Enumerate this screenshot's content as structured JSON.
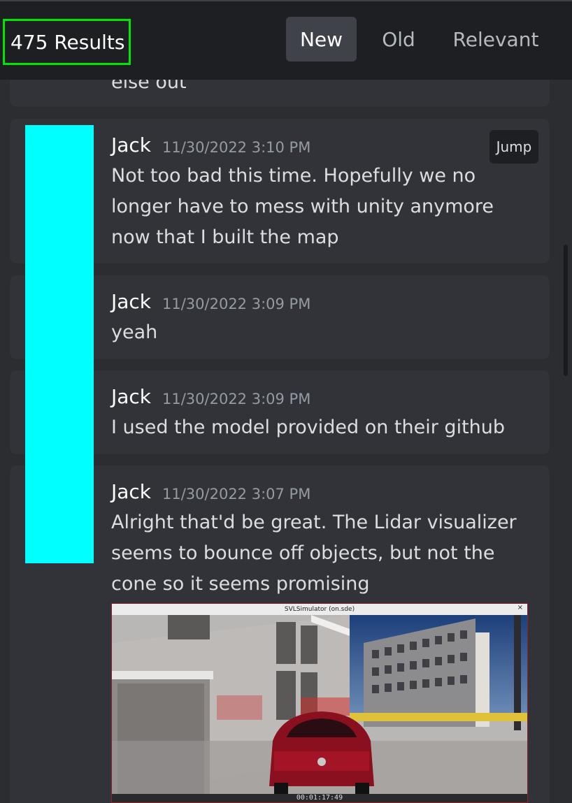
{
  "header": {
    "results_label": "475 Results",
    "sort_tabs": [
      {
        "label": "New",
        "active": true
      },
      {
        "label": "Old",
        "active": false
      },
      {
        "label": "Relevant",
        "active": false
      }
    ]
  },
  "partial_message": {
    "text": "else out"
  },
  "messages": [
    {
      "author": "Jack",
      "timestamp": "11/30/2022 3:10 PM",
      "lines": [
        "Not too bad this time. Hopefully we no",
        "longer have to mess with unity anymore",
        "now that I built the map"
      ],
      "jump_label": "Jump"
    },
    {
      "author": "Jack",
      "timestamp": "11/30/2022 3:09 PM",
      "lines": [
        "yeah"
      ]
    },
    {
      "author": "Jack",
      "timestamp": "11/30/2022 3:09 PM",
      "lines": [
        "I used the model provided on their github"
      ]
    },
    {
      "author": "Jack",
      "timestamp": "11/30/2022 3:07 PM",
      "lines": [
        "Alright that'd be great. The Lidar visualizer",
        "seems to bounce off objects, but not the",
        "cone so it seems promising"
      ],
      "attachment": {
        "window_title": "SVLSimulator (on.sde)",
        "close_glyph": "×",
        "timecode": "00:01:17:49"
      }
    }
  ],
  "colors": {
    "background": "#2b2d31",
    "card": "#313338",
    "topbar": "#1e1f22",
    "highlight_box": "#00e600",
    "redaction": "#00ffff"
  }
}
